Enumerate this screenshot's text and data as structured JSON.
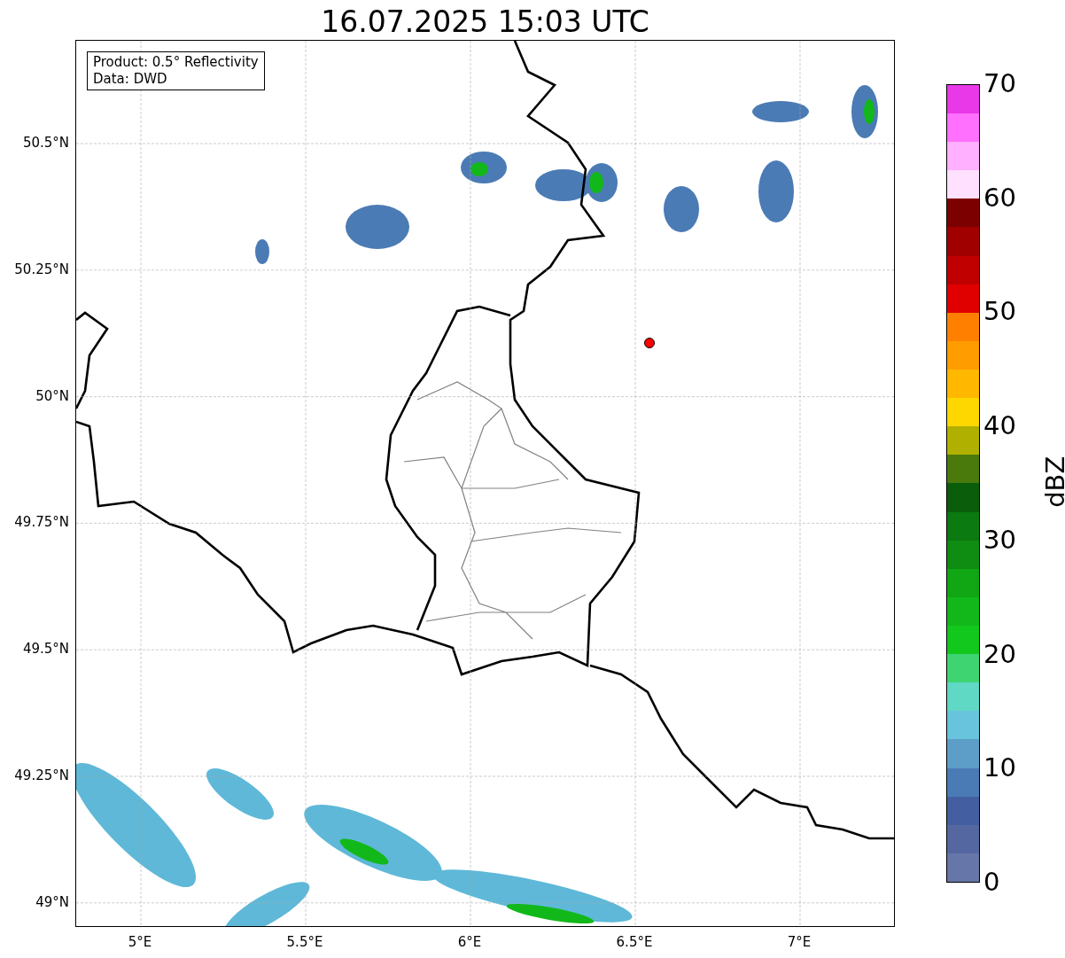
{
  "title": "16.07.2025 15:03 UTC",
  "info_box": [
    "Product: 0.5° Reflectivity",
    "Data: DWD"
  ],
  "x_ticks": [
    "5°E",
    "5.5°E",
    "6°E",
    "6.5°E",
    "7°E"
  ],
  "y_ticks": [
    "50.5°N",
    "50.25°N",
    "50°N",
    "49.75°N",
    "49.5°N",
    "49.25°N",
    "49°N"
  ],
  "colorbar": {
    "label": "dBZ",
    "ticks": [
      "70",
      "60",
      "50",
      "40",
      "30",
      "20",
      "10",
      "0"
    ],
    "segments": [
      {
        "color": "#6676a8"
      },
      {
        "color": "#5567a0"
      },
      {
        "color": "#435fa1"
      },
      {
        "color": "#4b7bb5"
      },
      {
        "color": "#5c9ec8"
      },
      {
        "color": "#68c4dc"
      },
      {
        "color": "#5fd8c4"
      },
      {
        "color": "#3ed472"
      },
      {
        "color": "#12c81c"
      },
      {
        "color": "#12b81a"
      },
      {
        "color": "#10a614"
      },
      {
        "color": "#0f8c12"
      },
      {
        "color": "#0b7a10"
      },
      {
        "color": "#0a5e0b"
      },
      {
        "color": "#4a7a0c"
      },
      {
        "color": "#b0b000"
      },
      {
        "color": "#ffd700"
      },
      {
        "color": "#ffb700"
      },
      {
        "color": "#ff9c00"
      },
      {
        "color": "#ff8000"
      },
      {
        "color": "#e00000"
      },
      {
        "color": "#c00000"
      },
      {
        "color": "#a00000"
      },
      {
        "color": "#7c0000"
      },
      {
        "color": "#ffe0ff"
      },
      {
        "color": "#ffb0ff"
      },
      {
        "color": "#ff70ff"
      },
      {
        "color": "#e838e8"
      }
    ]
  }
}
